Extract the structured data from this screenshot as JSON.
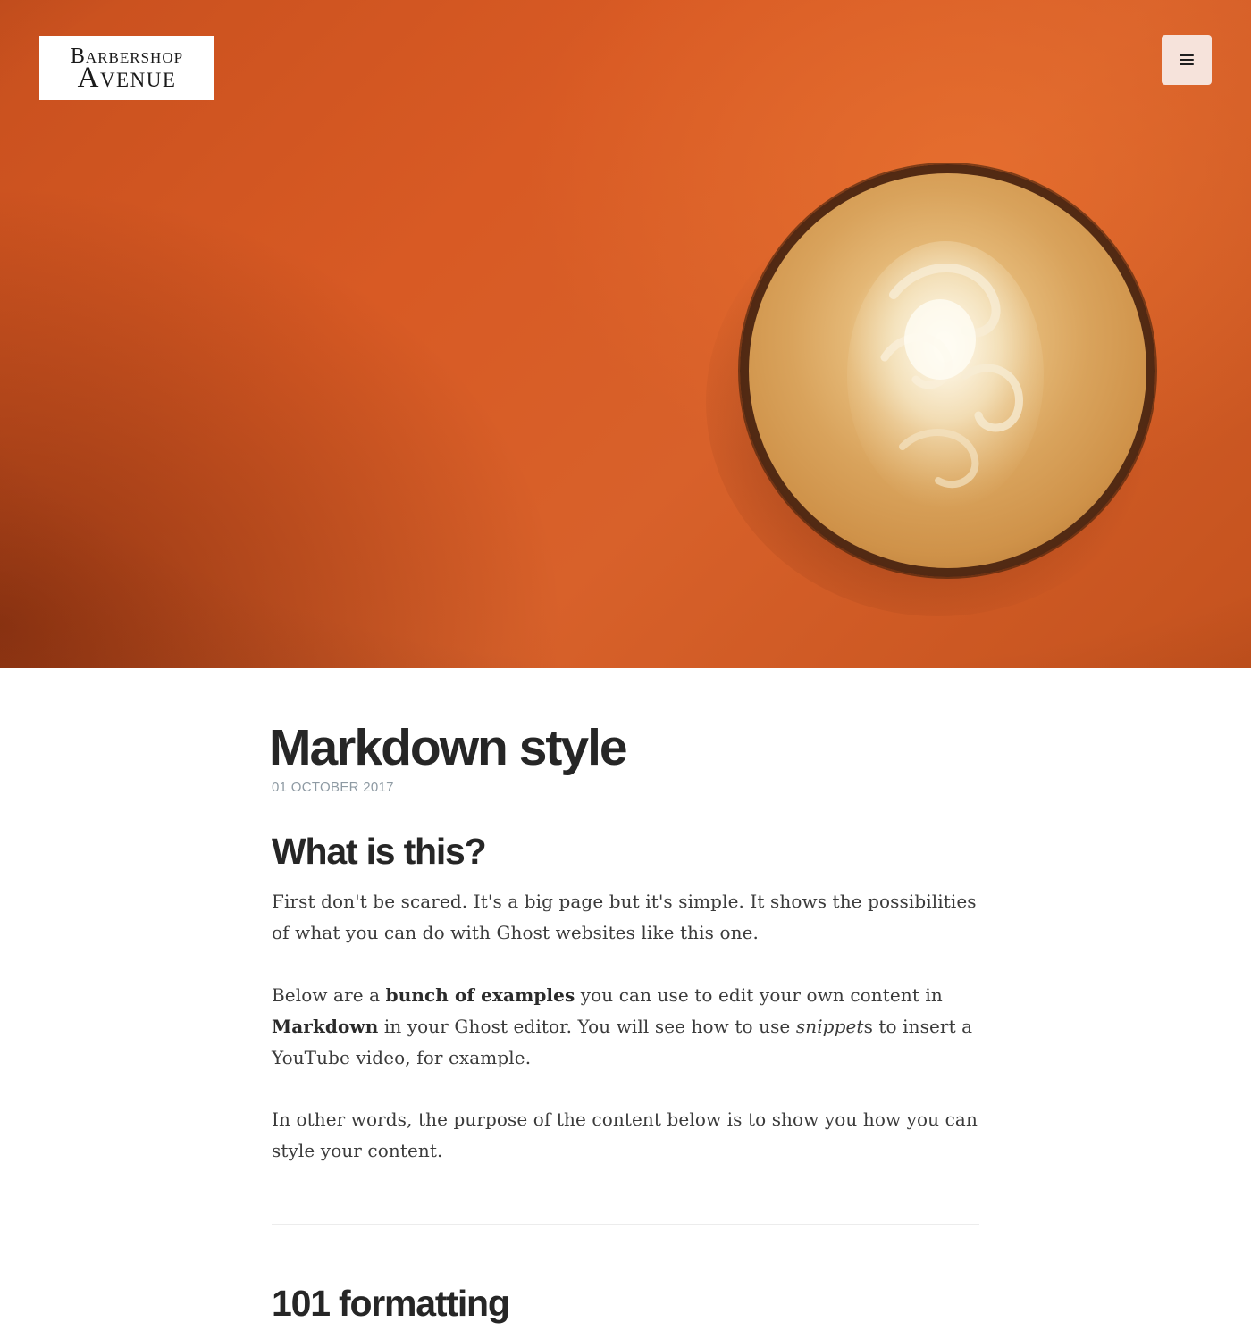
{
  "site": {
    "logo_line1": "Barbershop",
    "logo_line2": "Avenue",
    "menu_icon": "hamburger-menu-icon"
  },
  "colors": {
    "hero_orange": "#d85a24",
    "menu_button_bg": "#f6e3db",
    "title_text": "#262626",
    "date_text": "#8e9aa3",
    "body_text": "#3b3b3b"
  },
  "post": {
    "title": "Markdown style",
    "date": "01 OCTOBER 2017",
    "sections": [
      {
        "heading": "What is this?",
        "paragraphs": [
          {
            "text_1": "First don't be scared. It's a big page but it's simple. It shows the possibilities of what you can do with Ghost websites like this one."
          },
          {
            "text_1": "Below are a ",
            "bold_1": "bunch of examples",
            "text_2": " you can use to edit your own content in ",
            "bold_2": "Markdown",
            "text_3": " in your Ghost editor. You will see how to use ",
            "italic_1": "snippet",
            "text_4": "s to insert a YouTube video, for example."
          },
          {
            "text_1": "In other words, the purpose of the content below is to show you how you can style your content."
          }
        ]
      },
      {
        "heading": "101 formatting"
      }
    ]
  }
}
